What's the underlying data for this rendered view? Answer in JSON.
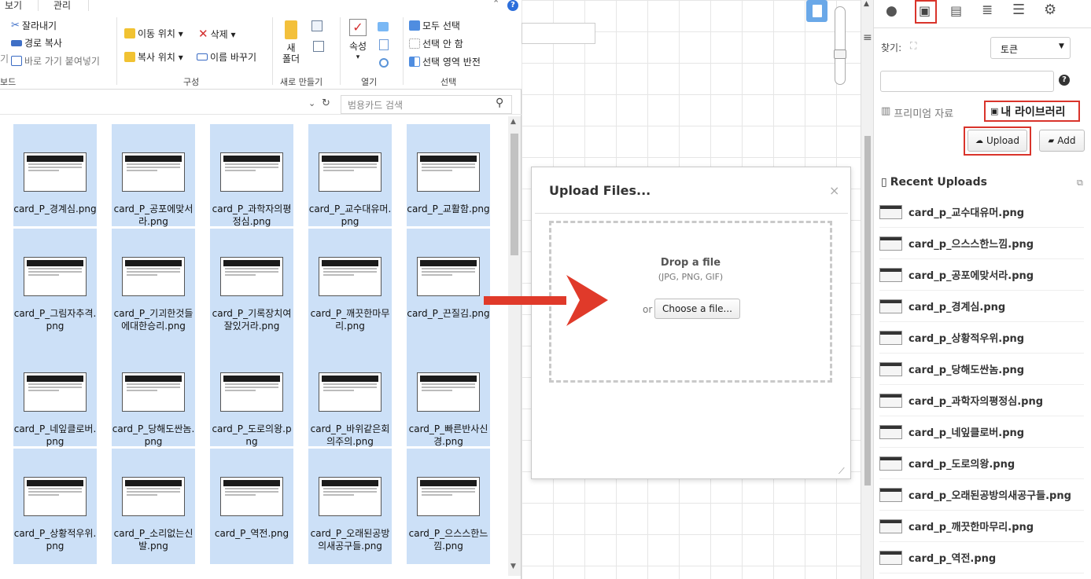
{
  "explorer": {
    "ribbon_tabs": [
      "보기",
      "관리"
    ],
    "clipboard": {
      "cut": "잘라내기",
      "copy_path": "경로 복사",
      "paste_shortcut": "바로 가기 붙여넣기",
      "label": "보드",
      "left_partial": "기"
    },
    "organize": {
      "move_to": "이동 위치 ▾",
      "delete": "삭제 ▾",
      "copy_to": "복사 위치 ▾",
      "rename": "이름 바꾸기",
      "label": "구성"
    },
    "new": {
      "new_folder_line1": "새",
      "new_folder_line2": "폴더",
      "label": "새로 만들기"
    },
    "open": {
      "properties": "속성",
      "label": "열기"
    },
    "select": {
      "select_all": "모두 선택",
      "select_none": "선택 안 함",
      "invert": "선택 영역 반전",
      "label": "선택"
    },
    "search_placeholder": "범용카드 검색",
    "files": [
      "card_P_경계심.png",
      "card_P_공포에맞서라.png",
      "card_P_과학자의평정심.png",
      "card_P_교수대유머.png",
      "card_P_교활함.png",
      "card_P_그림자추격.png",
      "card_P_기괴한것들에대한승리.png",
      "card_P_기록장치여잘있거라.png",
      "card_P_깨끗한마무리.png",
      "card_P_끈질김.png",
      "card_P_네잎클로버.png",
      "card_P_당해도싼놈.png",
      "card_P_도로의왕.png",
      "card_P_바위같은회의주의.png",
      "card_P_빠른반사신경.png",
      "card_P_상황적우위.png",
      "card_P_소리없는신발.png",
      "card_P_역전.png",
      "card_P_오래된공방의새공구들.png",
      "card_P_으스스한느낌.png"
    ]
  },
  "dialog": {
    "title": "Upload Files...",
    "close": "×",
    "drop_title": "Drop a file",
    "drop_types": "(JPG, PNG, GIF)",
    "or": "or",
    "choose_button": "Choose a file..."
  },
  "right_panel": {
    "find_label": "찾기:",
    "size_select": "토큰",
    "premium_tab": "프리미엄 자료",
    "library_tab": "내 라이브러리",
    "upload_button": "Upload",
    "add_button": "Add",
    "recent_title": "Recent Uploads",
    "recent": [
      "card_p_교수대유머.png",
      "card_p_으스스한느낌.png",
      "card_p_공포에맞서라.png",
      "card_p_경계심.png",
      "card_p_상황적우위.png",
      "card_p_당해도싼놈.png",
      "card_p_과학자의평정심.png",
      "card_p_네잎클로버.png",
      "card_p_도로의왕.png",
      "card_p_오래된공방의새공구들.png",
      "card_p_깨끗한마무리.png",
      "card_p_역전.png"
    ]
  },
  "colors": {
    "highlight_red": "#d9342b",
    "arrow_red": "#e03a2a",
    "selection_blue": "#cce0f7"
  }
}
